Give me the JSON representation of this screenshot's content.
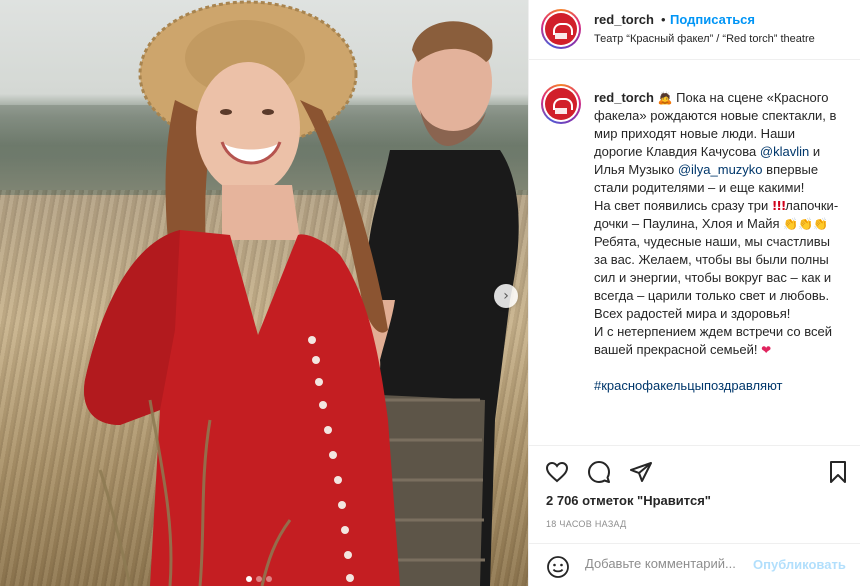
{
  "post": {
    "username": "red_torch",
    "separator": "•",
    "follow_label": "Подписаться",
    "location": "Театр “Красный факел” / “Red torch” theatre"
  },
  "caption": {
    "username": "red_torch",
    "part1": " Пока на сцене «Красного факела» рождаются новые спектакли, в мир приходят новые люди. Наши дорогие Клавдия Качусова ",
    "mention1": "@klavlin",
    "part2": " и Илья Музыко ",
    "mention2": "@ilya_muzyko",
    "part3": " впервые стали родителями – и еще какими!",
    "line2": "На свет появились сразу три ",
    "line2b": "лапочки-дочки – Паулина, Хлоя и Майя ",
    "line3": "Ребята, чудесные наши, мы счастливы за вас. Желаем, чтобы вы были полны сил и энергии, чтобы вокруг вас – как и всегда – царили только свет и любовь. Всех радостей мира и здоровья!",
    "line4": "И с нетерпением ждем встречи со всей вашей прекрасной семьей! ",
    "hashtag": "#краснофакельцыпоздравляют"
  },
  "emoji": {
    "woman": "🙇",
    "exclamations": "!!!",
    "claps": "👏👏👏",
    "heart": "❤"
  },
  "actions": {
    "likes": "2 706 отметок \"Нравится\"",
    "timestamp": "18 ЧАСОВ НАЗАД"
  },
  "comment": {
    "placeholder": "Добавьте комментарий...",
    "post_label": "Опубликовать"
  },
  "colors": {
    "accent": "#0095f6",
    "post_disabled": "#b2dffc",
    "dress": "#c41e22",
    "border": "#efefef"
  },
  "carousel": {
    "next_glyph": "›",
    "slide_count": 3,
    "active_index": 0
  }
}
